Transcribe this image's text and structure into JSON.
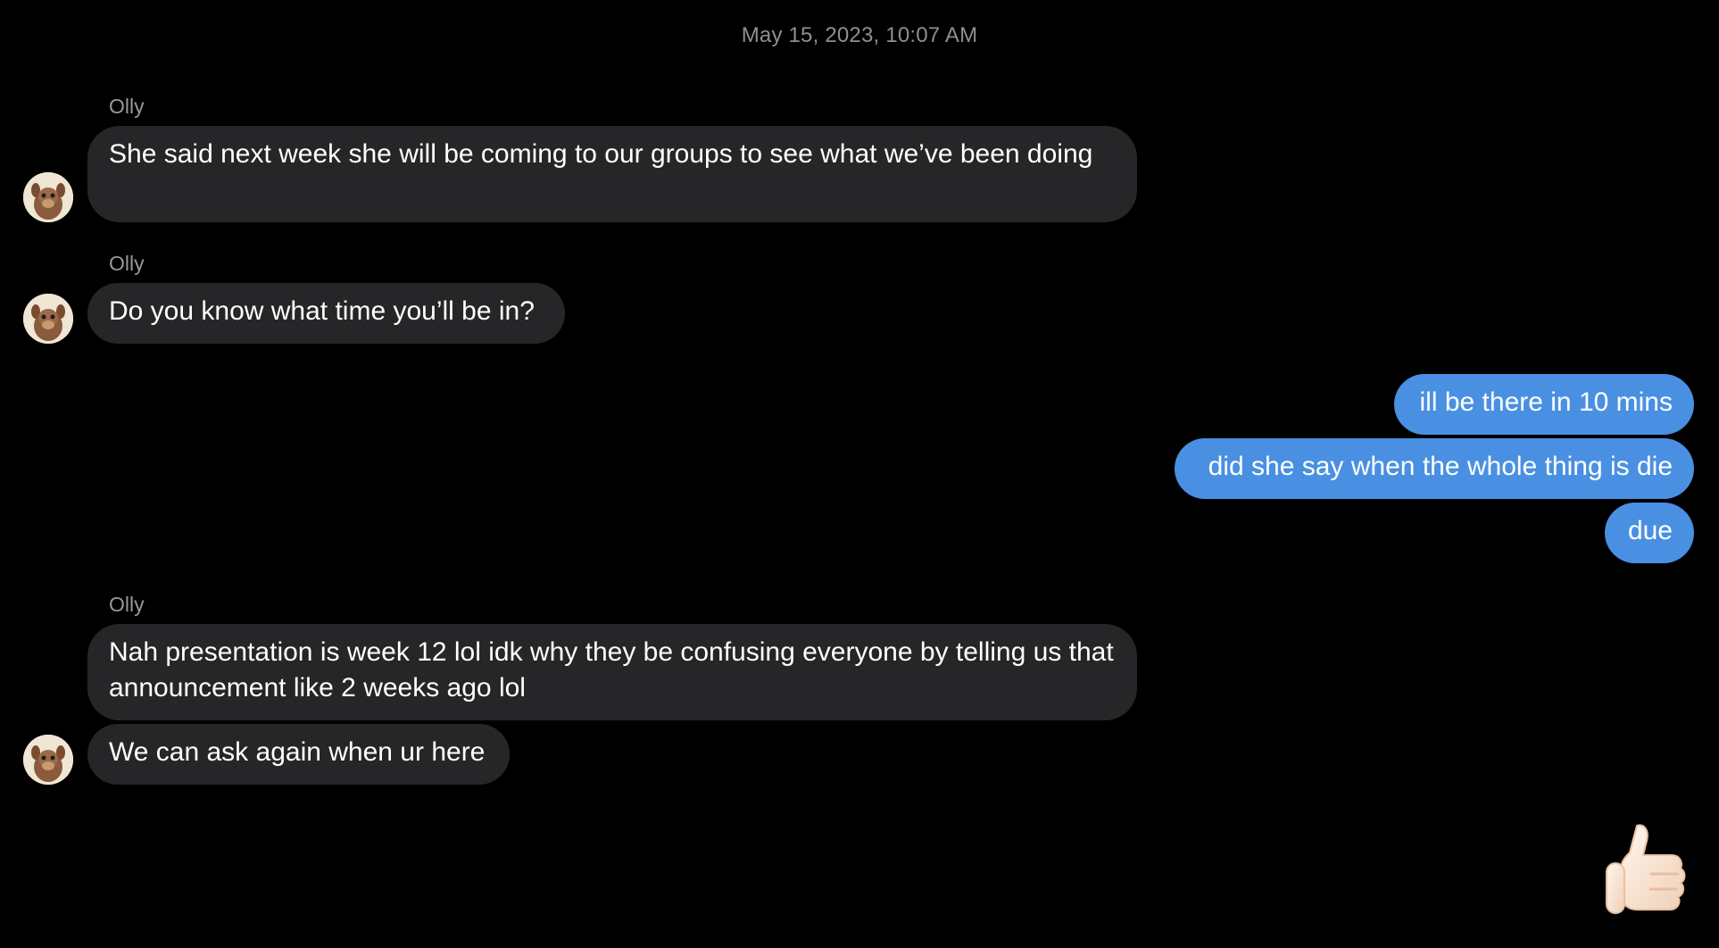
{
  "thread": {
    "timestamp": "May 15, 2023, 10:07 AM",
    "messages": [
      {
        "sender": "Olly",
        "text": "She said next week she will be coming to our groups to see what we’ve been doing"
      },
      {
        "sender": "Olly",
        "text": "Do you know what time you’ll be in?"
      },
      {
        "text": "ill be there in 10 mins"
      },
      {
        "text": "did she say when the whole thing is die"
      },
      {
        "text": "due"
      },
      {
        "sender": "Olly",
        "text": "Nah presentation is week 12 lol idk why they be confusing everyone by telling us that announcement like 2 weeks ago lol"
      },
      {
        "text": "We can ask again when ur here"
      }
    ],
    "reaction_icon": "thumbs-up-icon",
    "avatar_icon": "monkey-avatar-icon"
  },
  "colors": {
    "background": "#000000",
    "incoming_bubble": "#262628",
    "outgoing_bubble": "#4a90e2",
    "timestamp": "#8e8e93",
    "sender_name": "#98989d"
  }
}
